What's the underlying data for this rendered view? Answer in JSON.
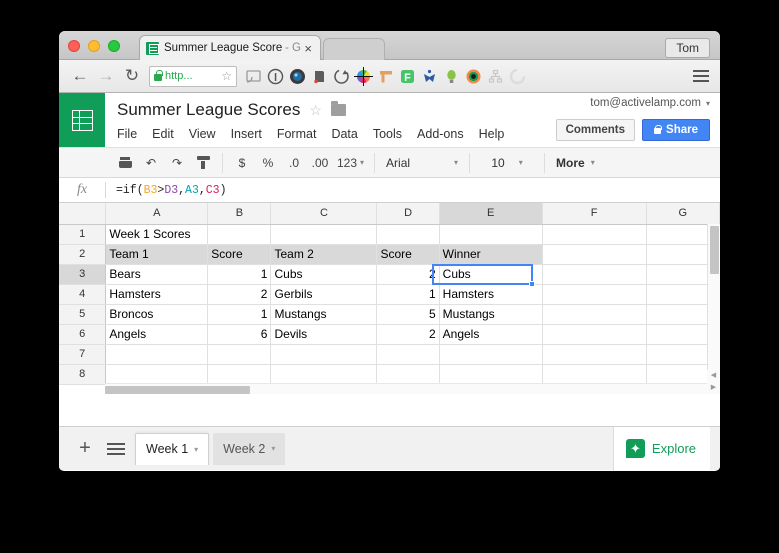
{
  "browser": {
    "tab": {
      "title": "Summer League Scores",
      "suffix": "- G",
      "close": "×"
    },
    "nav": {
      "back": "←",
      "forward": "→",
      "reload": "↻"
    },
    "omnibox": {
      "url": "http...",
      "star": "☆",
      "lock_icon": "lock-icon"
    },
    "profile_label": "Tom",
    "extensions": [
      "cast-icon",
      "info-icon",
      "camera-icon",
      "evernote-icon",
      "refresh-circle-icon",
      "color-wheel-icon",
      "ruler-icon",
      "f-icon",
      "person-icon",
      "bulb-icon",
      "eye-icon",
      "sitemap-icon",
      "spinner-icon"
    ],
    "menu_icon": "hamburger-menu-icon"
  },
  "sheets": {
    "logo": "sheets-logo-icon",
    "doc_title": "Summer League Scores",
    "star": "☆",
    "folder": "folder-icon",
    "menus": [
      "File",
      "Edit",
      "View",
      "Insert",
      "Format",
      "Data",
      "Tools",
      "Add-ons",
      "Help"
    ],
    "account_email": "tom@activelamp.com",
    "comments_label": "Comments",
    "share_label": "Share",
    "toolbar": {
      "print": "print-icon",
      "undo": "↶",
      "redo": "↷",
      "paint_format": "paint-format-icon",
      "currency": "$",
      "percent": "%",
      "decrease_decimal": ".0",
      "increase_decimal": ".00",
      "more_formats": "123",
      "font_name": "Arial",
      "font_size": "10",
      "more_label": "More",
      "caret": "▾"
    },
    "formula_bar": {
      "fx": "fx",
      "formula_full": "=if(B3>D3,A3,C3)",
      "parts": {
        "p1": "=if(",
        "ref_b": "B3",
        "gt": ">",
        "ref_d": "D3",
        "c1": ",",
        "ref_a": "A3",
        "c2": ",",
        "ref_c": "C3",
        "p2": ")"
      },
      "ref_colors": {
        "b": "#f5a623",
        "d": "#8e44ad",
        "a": "#00a3b0",
        "c": "#d81b60"
      }
    },
    "grid": {
      "columns": [
        "A",
        "B",
        "C",
        "D",
        "E",
        "F",
        "G"
      ],
      "rows": [
        "1",
        "2",
        "3",
        "4",
        "5",
        "6",
        "7",
        "8"
      ],
      "selected_cell": "E3",
      "selected_column": "E",
      "selected_row": "3",
      "selection_color": "#4285f4",
      "cells": [
        {
          "A": "Week 1 Scores",
          "B": "",
          "C": "",
          "D": "",
          "E": "",
          "F": "",
          "G": ""
        },
        {
          "A": "Team 1",
          "B": "Score",
          "C": "Team 2",
          "D": "Score",
          "E": "Winner",
          "F": "",
          "G": ""
        },
        {
          "A": "Bears",
          "B": "1",
          "C": "Cubs",
          "D": "2",
          "E": "Cubs",
          "F": "",
          "G": ""
        },
        {
          "A": "Hamsters",
          "B": "2",
          "C": "Gerbils",
          "D": "1",
          "E": "Hamsters",
          "F": "",
          "G": ""
        },
        {
          "A": "Broncos",
          "B": "1",
          "C": "Mustangs",
          "D": "5",
          "E": "Mustangs",
          "F": "",
          "G": ""
        },
        {
          "A": "Angels",
          "B": "6",
          "C": "Devils",
          "D": "2",
          "E": "Angels",
          "F": "",
          "G": ""
        },
        {
          "A": "",
          "B": "",
          "C": "",
          "D": "",
          "E": "",
          "F": "",
          "G": ""
        },
        {
          "A": "",
          "B": "",
          "C": "",
          "D": "",
          "E": "",
          "F": "",
          "G": ""
        }
      ]
    },
    "sheet_tabs": [
      {
        "label": "Week 1",
        "active": true,
        "caret": "▾"
      },
      {
        "label": "Week 2",
        "active": false,
        "caret": "▾"
      }
    ],
    "add_sheet": "+",
    "all_sheets": "all-sheets-icon",
    "explore_label": "Explore",
    "explore_icon": "✦",
    "scroll": {
      "left_arrow": "◀",
      "right_arrow": "▶"
    }
  }
}
